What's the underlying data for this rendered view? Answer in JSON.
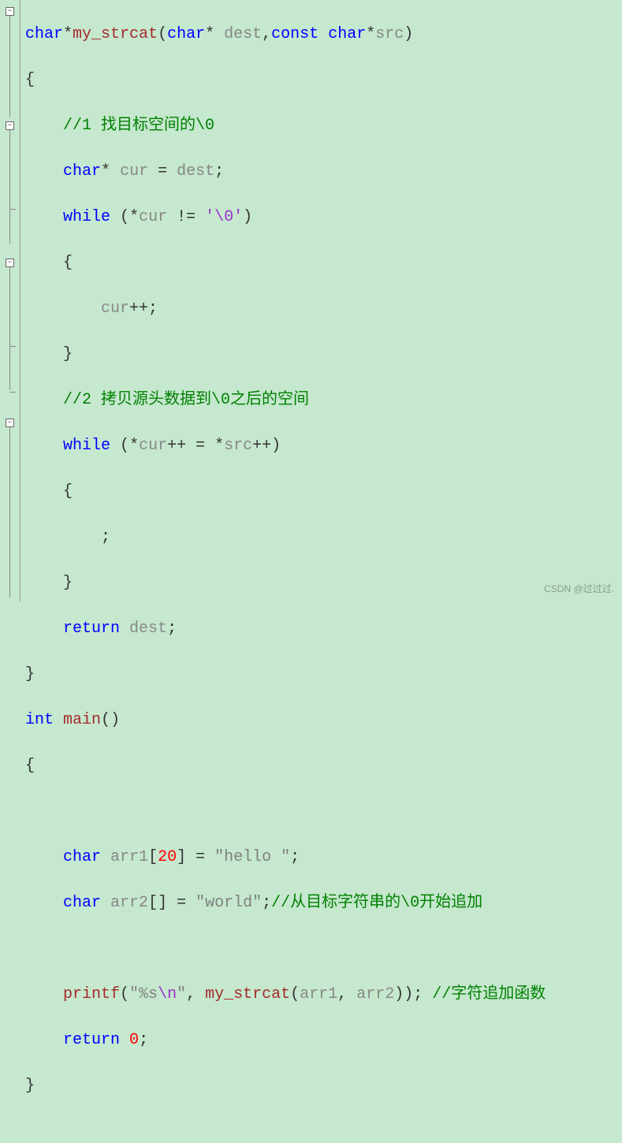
{
  "tokens": {
    "kw_char": "char",
    "kw_const": "const",
    "kw_while": "while",
    "kw_return": "return",
    "kw_int": "int",
    "fn_my_strcat": "my_strcat",
    "fn_main": "main",
    "fn_printf": "printf",
    "id_dest": "dest",
    "id_src": "src",
    "id_cur": "cur",
    "id_arr1": "arr1",
    "id_arr2": "arr2",
    "comment1": "//1 找目标空间的\\0",
    "comment2": "//2 拷贝源头数据到\\0之后的空间",
    "comment3": "//从目标字符串的\\0开始追加",
    "comment4": "//字符追加函数",
    "char_esc0": "'\\0'",
    "str_hello_open": "\"hello ",
    "str_hello_close": "\"",
    "str_world_open": "\"world",
    "str_world_close": "\"",
    "str_fmt_open": "\"%s",
    "str_fmt_esc": "\\n",
    "str_fmt_close": "\"",
    "num_20": "20",
    "num_0": "0",
    "star": "*",
    "comma": ",",
    "lparen": "(",
    "rparen": ")",
    "lbrace": "{",
    "rbrace": "}",
    "lbracket": "[",
    "rbracket": "]",
    "eq": " = ",
    "neq": " != ",
    "pp": "++",
    "semi": ";",
    "comma_sp": ", ",
    "rparen_semi": ");",
    "rparen_rparen_semi": ")); "
  },
  "watermark": "CSDN @过过过."
}
